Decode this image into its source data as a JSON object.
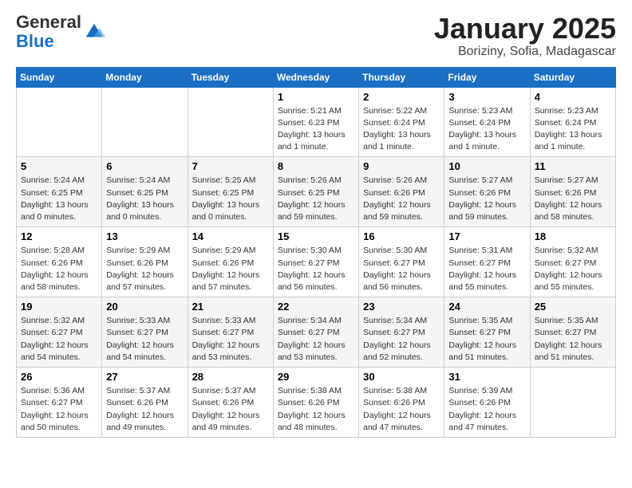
{
  "logo": {
    "general": "General",
    "blue": "Blue"
  },
  "title": "January 2025",
  "subtitle": "Boriziny, Sofia, Madagascar",
  "days_of_week": [
    "Sunday",
    "Monday",
    "Tuesday",
    "Wednesday",
    "Thursday",
    "Friday",
    "Saturday"
  ],
  "weeks": [
    [
      {
        "day": "",
        "info": ""
      },
      {
        "day": "",
        "info": ""
      },
      {
        "day": "",
        "info": ""
      },
      {
        "day": "1",
        "info": "Sunrise: 5:21 AM\nSunset: 6:23 PM\nDaylight: 13 hours and 1 minute."
      },
      {
        "day": "2",
        "info": "Sunrise: 5:22 AM\nSunset: 6:24 PM\nDaylight: 13 hours and 1 minute."
      },
      {
        "day": "3",
        "info": "Sunrise: 5:23 AM\nSunset: 6:24 PM\nDaylight: 13 hours and 1 minute."
      },
      {
        "day": "4",
        "info": "Sunrise: 5:23 AM\nSunset: 6:24 PM\nDaylight: 13 hours and 1 minute."
      }
    ],
    [
      {
        "day": "5",
        "info": "Sunrise: 5:24 AM\nSunset: 6:25 PM\nDaylight: 13 hours and 0 minutes."
      },
      {
        "day": "6",
        "info": "Sunrise: 5:24 AM\nSunset: 6:25 PM\nDaylight: 13 hours and 0 minutes."
      },
      {
        "day": "7",
        "info": "Sunrise: 5:25 AM\nSunset: 6:25 PM\nDaylight: 13 hours and 0 minutes."
      },
      {
        "day": "8",
        "info": "Sunrise: 5:26 AM\nSunset: 6:25 PM\nDaylight: 12 hours and 59 minutes."
      },
      {
        "day": "9",
        "info": "Sunrise: 5:26 AM\nSunset: 6:26 PM\nDaylight: 12 hours and 59 minutes."
      },
      {
        "day": "10",
        "info": "Sunrise: 5:27 AM\nSunset: 6:26 PM\nDaylight: 12 hours and 59 minutes."
      },
      {
        "day": "11",
        "info": "Sunrise: 5:27 AM\nSunset: 6:26 PM\nDaylight: 12 hours and 58 minutes."
      }
    ],
    [
      {
        "day": "12",
        "info": "Sunrise: 5:28 AM\nSunset: 6:26 PM\nDaylight: 12 hours and 58 minutes."
      },
      {
        "day": "13",
        "info": "Sunrise: 5:29 AM\nSunset: 6:26 PM\nDaylight: 12 hours and 57 minutes."
      },
      {
        "day": "14",
        "info": "Sunrise: 5:29 AM\nSunset: 6:26 PM\nDaylight: 12 hours and 57 minutes."
      },
      {
        "day": "15",
        "info": "Sunrise: 5:30 AM\nSunset: 6:27 PM\nDaylight: 12 hours and 56 minutes."
      },
      {
        "day": "16",
        "info": "Sunrise: 5:30 AM\nSunset: 6:27 PM\nDaylight: 12 hours and 56 minutes."
      },
      {
        "day": "17",
        "info": "Sunrise: 5:31 AM\nSunset: 6:27 PM\nDaylight: 12 hours and 55 minutes."
      },
      {
        "day": "18",
        "info": "Sunrise: 5:32 AM\nSunset: 6:27 PM\nDaylight: 12 hours and 55 minutes."
      }
    ],
    [
      {
        "day": "19",
        "info": "Sunrise: 5:32 AM\nSunset: 6:27 PM\nDaylight: 12 hours and 54 minutes."
      },
      {
        "day": "20",
        "info": "Sunrise: 5:33 AM\nSunset: 6:27 PM\nDaylight: 12 hours and 54 minutes."
      },
      {
        "day": "21",
        "info": "Sunrise: 5:33 AM\nSunset: 6:27 PM\nDaylight: 12 hours and 53 minutes."
      },
      {
        "day": "22",
        "info": "Sunrise: 5:34 AM\nSunset: 6:27 PM\nDaylight: 12 hours and 53 minutes."
      },
      {
        "day": "23",
        "info": "Sunrise: 5:34 AM\nSunset: 6:27 PM\nDaylight: 12 hours and 52 minutes."
      },
      {
        "day": "24",
        "info": "Sunrise: 5:35 AM\nSunset: 6:27 PM\nDaylight: 12 hours and 51 minutes."
      },
      {
        "day": "25",
        "info": "Sunrise: 5:35 AM\nSunset: 6:27 PM\nDaylight: 12 hours and 51 minutes."
      }
    ],
    [
      {
        "day": "26",
        "info": "Sunrise: 5:36 AM\nSunset: 6:27 PM\nDaylight: 12 hours and 50 minutes."
      },
      {
        "day": "27",
        "info": "Sunrise: 5:37 AM\nSunset: 6:26 PM\nDaylight: 12 hours and 49 minutes."
      },
      {
        "day": "28",
        "info": "Sunrise: 5:37 AM\nSunset: 6:26 PM\nDaylight: 12 hours and 49 minutes."
      },
      {
        "day": "29",
        "info": "Sunrise: 5:38 AM\nSunset: 6:26 PM\nDaylight: 12 hours and 48 minutes."
      },
      {
        "day": "30",
        "info": "Sunrise: 5:38 AM\nSunset: 6:26 PM\nDaylight: 12 hours and 47 minutes."
      },
      {
        "day": "31",
        "info": "Sunrise: 5:39 AM\nSunset: 6:26 PM\nDaylight: 12 hours and 47 minutes."
      },
      {
        "day": "",
        "info": ""
      }
    ]
  ]
}
